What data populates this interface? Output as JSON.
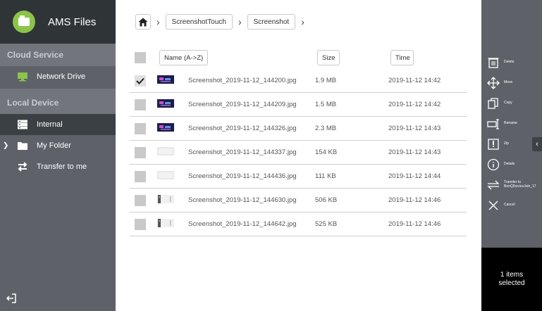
{
  "app": {
    "title": "AMS Files"
  },
  "sidebar": {
    "cloud_section": "Cloud Service",
    "cloud_items": [
      {
        "label": "Network Drive"
      }
    ],
    "local_section": "Local Device",
    "local_items": [
      {
        "label": "Internal"
      },
      {
        "label": "My Folder"
      },
      {
        "label": "Transfer to me"
      }
    ]
  },
  "breadcrumb": {
    "items": [
      "ScreenshotTouch",
      "Screenshot"
    ]
  },
  "table": {
    "headers": {
      "name": "Name (A->Z)",
      "size": "Size",
      "time": "Time"
    },
    "rows": [
      {
        "name": "Screenshot_2019-11-12_144200.jpg",
        "size": "1.9 MB",
        "time": "2019-11-12 14:42",
        "checked": true,
        "thumb": "dark"
      },
      {
        "name": "Screenshot_2019-11-12_144209.jpg",
        "size": "1.5 MB",
        "time": "2019-11-12 14:42",
        "checked": false,
        "thumb": "dark"
      },
      {
        "name": "Screenshot_2019-11-12_144326.jpg",
        "size": "2.3 MB",
        "time": "2019-11-12 14:43",
        "checked": false,
        "thumb": "dark"
      },
      {
        "name": "Screenshot_2019-11-12_144337.jpg",
        "size": "154 KB",
        "time": "2019-11-12 14:43",
        "checked": false,
        "thumb": "light"
      },
      {
        "name": "Screenshot_2019-11-12_144436.jpg",
        "size": "111 KB",
        "time": "2019-11-12 14:44",
        "checked": false,
        "thumb": "light"
      },
      {
        "name": "Screenshot_2019-11-12_144630.jpg",
        "size": "506 KB",
        "time": "2019-11-12 14:46",
        "checked": false,
        "thumb": "mixed"
      },
      {
        "name": "Screenshot_2019-11-12_144642.jpg",
        "size": "525 KB",
        "time": "2019-11-12 14:46",
        "checked": false,
        "thumb": "mixed"
      }
    ]
  },
  "actions": {
    "items": [
      {
        "label": "Delete",
        "icon": "trash-icon"
      },
      {
        "label": "Move",
        "icon": "move-icon"
      },
      {
        "label": "Copy",
        "icon": "copy-icon"
      },
      {
        "label": "Rename",
        "icon": "rename-icon"
      },
      {
        "label": "Zip",
        "icon": "zip-icon"
      },
      {
        "label": "Details",
        "icon": "info-icon"
      },
      {
        "label": "Transfer to\nBenQDeviceJoin_17",
        "icon": "transfer-icon"
      },
      {
        "label": "Cancel",
        "icon": "close-icon"
      }
    ],
    "selected_count": "1 items",
    "selected_label": "selected"
  },
  "colors": {
    "sidebar_bg": "#5e6168",
    "header_bg": "#2f3436",
    "active_bg": "#3a4043",
    "accent_green": "#8cc34a",
    "panel_black": "#000000"
  }
}
